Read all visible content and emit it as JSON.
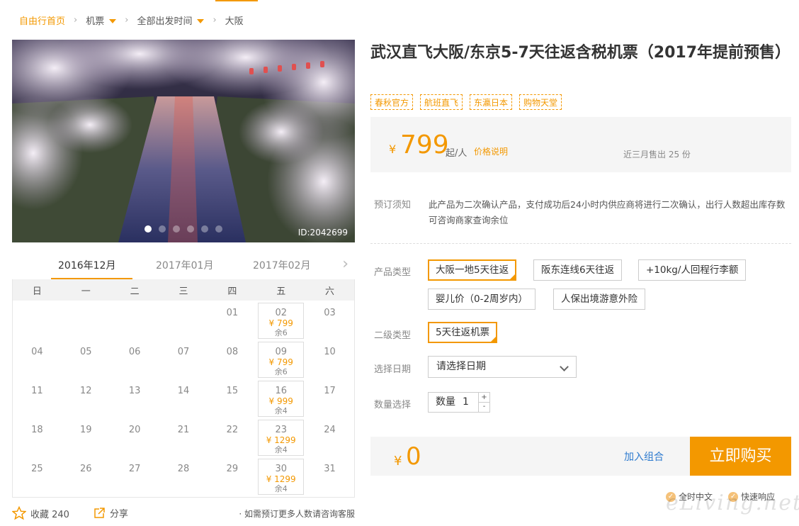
{
  "breadcrumb": {
    "home": "自由行首页",
    "flight": "机票",
    "departure": "全部出发时间",
    "city": "大阪"
  },
  "gallery": {
    "image_id": "ID:2042699",
    "dots": 6,
    "active_dot": 1
  },
  "calendar": {
    "months": [
      "2016年12月",
      "2017年01月",
      "2017年02月"
    ],
    "active_month": 0,
    "weekdays": [
      "日",
      "一",
      "二",
      "三",
      "四",
      "五",
      "六"
    ],
    "leading_blanks": 4,
    "days": [
      {
        "d": "01"
      },
      {
        "d": "02",
        "price": "¥ 799",
        "stock": "余6"
      },
      {
        "d": "03"
      },
      {
        "d": "04"
      },
      {
        "d": "05"
      },
      {
        "d": "06"
      },
      {
        "d": "07"
      },
      {
        "d": "08"
      },
      {
        "d": "09",
        "price": "¥ 799",
        "stock": "余6"
      },
      {
        "d": "10"
      },
      {
        "d": "11"
      },
      {
        "d": "12"
      },
      {
        "d": "13"
      },
      {
        "d": "14"
      },
      {
        "d": "15"
      },
      {
        "d": "16",
        "price": "¥ 999",
        "stock": "余4"
      },
      {
        "d": "17"
      },
      {
        "d": "18"
      },
      {
        "d": "19"
      },
      {
        "d": "20"
      },
      {
        "d": "21"
      },
      {
        "d": "22"
      },
      {
        "d": "23",
        "price": "¥ 1299",
        "stock": "余4"
      },
      {
        "d": "24"
      },
      {
        "d": "25"
      },
      {
        "d": "26"
      },
      {
        "d": "27"
      },
      {
        "d": "28"
      },
      {
        "d": "29"
      },
      {
        "d": "30",
        "price": "¥ 1299",
        "stock": "余4"
      },
      {
        "d": "31"
      }
    ]
  },
  "actions": {
    "favorite": "收藏 240",
    "share": "分享",
    "note": "· 如需预订更多人数请咨询客服"
  },
  "product": {
    "title": "武汉直飞大阪/东京5-7天往返含税机票（2017年提前预售）",
    "tags": [
      "春秋官方",
      "航班直飞",
      "东瀛日本",
      "购物天堂"
    ],
    "price_currency": "¥",
    "price": "799",
    "price_unit": "起/人",
    "price_explain": "价格说明",
    "sold": "近三月售出 25 份"
  },
  "notice": {
    "label": "预订须知",
    "text": "此产品为二次确认产品，支付成功后24小时内供应商将进行二次确认，出行人数超出库存数可咨询商家查询余位"
  },
  "options": {
    "type_label": "产品类型",
    "types": [
      "大阪一地5天往返",
      "阪东连线6天往返",
      "+10kg/人回程行李额",
      "婴儿价（0-2周岁内）",
      "人保出境游意外险"
    ],
    "selected_type": 0,
    "subtype_label": "二级类型",
    "subtype": "5天往返机票",
    "date_label": "选择日期",
    "date_placeholder": "请选择日期",
    "qty_label": "数量选择",
    "qty_text": "数量",
    "qty_value": "1",
    "qty_up": "+",
    "qty_down": "-"
  },
  "buy": {
    "currency": "¥",
    "total": "0",
    "combo": "加入组合",
    "button": "立即购买"
  },
  "services": [
    "全时中文",
    "快速响应"
  ],
  "watermark": "eLiving.net",
  "colors": {
    "accent": "#f39800",
    "link": "#2e7bcf"
  }
}
